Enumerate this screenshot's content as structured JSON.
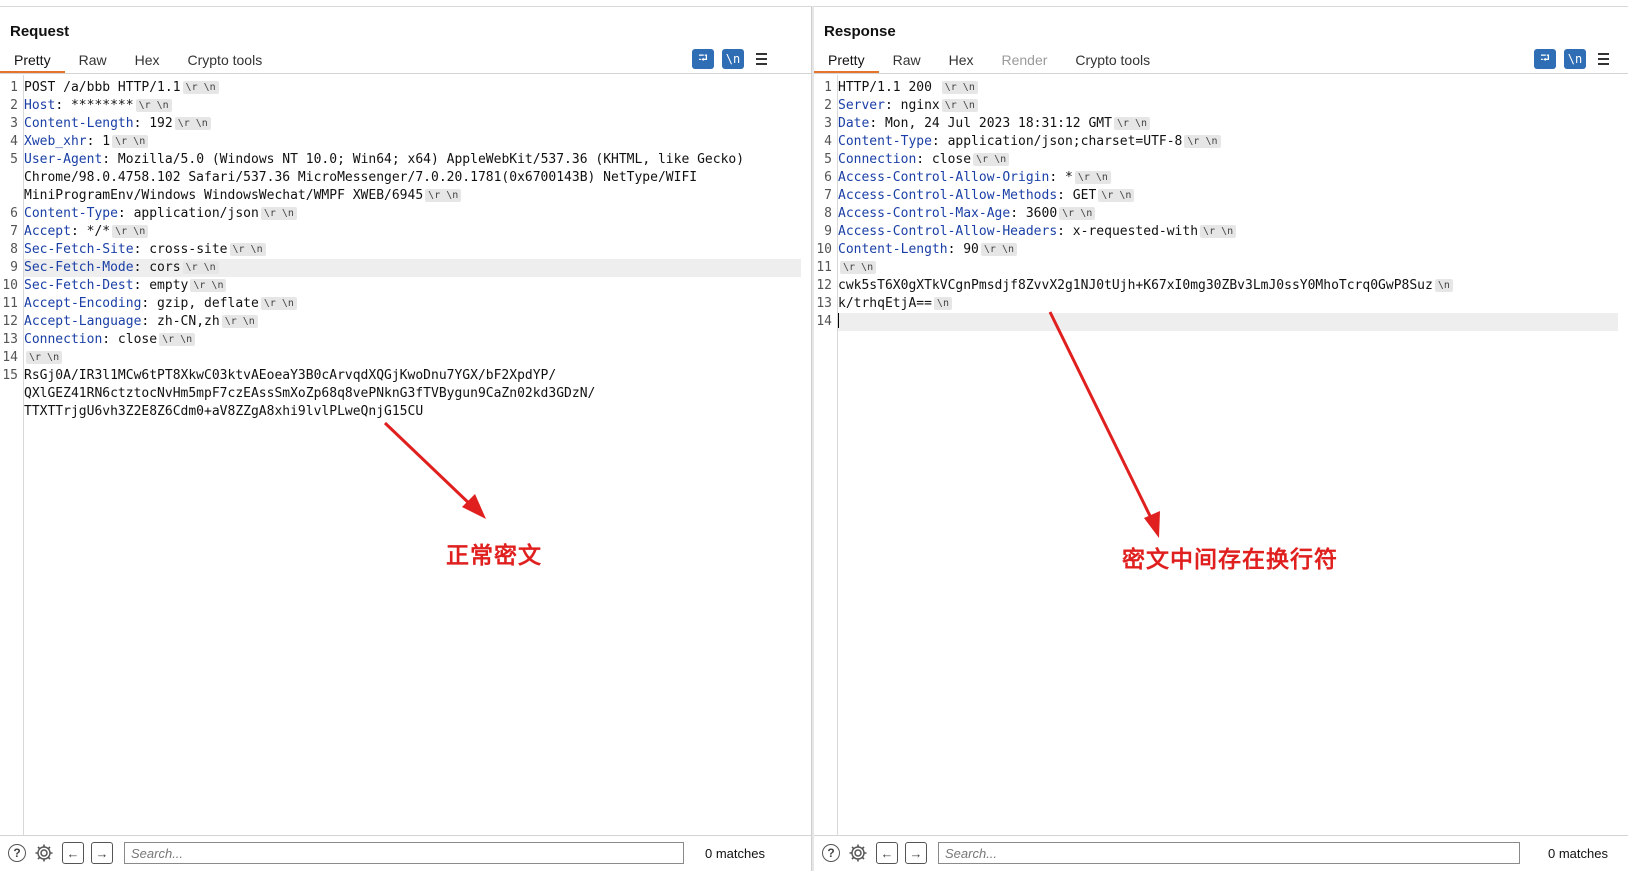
{
  "request": {
    "title": "Request",
    "tabs": [
      "Pretty",
      "Raw",
      "Hex",
      "Crypto tools"
    ],
    "active_tab": "Pretty",
    "lines": [
      {
        "n": "1",
        "key": "",
        "val": "POST /a/bbb HTTP/1.1",
        "eol": "\\r \\n"
      },
      {
        "n": "2",
        "key": "Host",
        "val": " ********",
        "eol": "\\r \\n"
      },
      {
        "n": "3",
        "key": "Content-Length",
        "val": " 192",
        "eol": "\\r \\n"
      },
      {
        "n": "4",
        "key": "Xweb_xhr",
        "val": " 1",
        "eol": "\\r \\n"
      },
      {
        "n": "5",
        "key": "User-Agent",
        "val": " Mozilla/5.0 (Windows NT 10.0; Win64; x64) AppleWebKit/537.36 (KHTML, like Gecko)",
        "eol": ""
      },
      {
        "n": "",
        "key": "",
        "val": "Chrome/98.0.4758.102 Safari/537.36 MicroMessenger/7.0.20.1781(0x6700143B) NetType/WIFI",
        "eol": ""
      },
      {
        "n": "",
        "key": "",
        "val": "MiniProgramEnv/Windows WindowsWechat/WMPF XWEB/6945",
        "eol": "\\r \\n"
      },
      {
        "n": "6",
        "key": "Content-Type",
        "val": " application/json",
        "eol": "\\r \\n"
      },
      {
        "n": "7",
        "key": "Accept",
        "val": " */*",
        "eol": "\\r \\n"
      },
      {
        "n": "8",
        "key": "Sec-Fetch-Site",
        "val": " cross-site",
        "eol": "\\r \\n"
      },
      {
        "n": "9",
        "key": "Sec-Fetch-Mode",
        "val": " cors",
        "eol": "\\r \\n",
        "highlight": true
      },
      {
        "n": "10",
        "key": "Sec-Fetch-Dest",
        "val": " empty",
        "eol": "\\r \\n"
      },
      {
        "n": "11",
        "key": "Accept-Encoding",
        "val": " gzip, deflate",
        "eol": "\\r \\n"
      },
      {
        "n": "12",
        "key": "Accept-Language",
        "val": " zh-CN,zh",
        "eol": "\\r \\n"
      },
      {
        "n": "13",
        "key": "Connection",
        "val": " close",
        "eol": "\\r \\n"
      },
      {
        "n": "14",
        "key": "",
        "val": "",
        "eol": "\\r \\n"
      },
      {
        "n": "15",
        "key": "",
        "val": "RsGj0A/IR3l1MCw6tPT8XkwC03ktvAEoeaY3B0cArvqdXQGjKwoDnu7YGX/bF2XpdYP/",
        "eol": ""
      },
      {
        "n": "",
        "key": "",
        "val": "QXlGEZ41RN6ctztocNvHm5mpF7czEAssSmXoZp68q8vePNknG3fTVBygun9CaZn02kd3GDzN/",
        "eol": ""
      },
      {
        "n": "",
        "key": "",
        "val": "TTXTTrjgU6vh3Z2E8Z6Cdm0+aV8ZZgA8xhi9lvlPLweQnjG15CU",
        "eol": ""
      }
    ],
    "search_placeholder": "Search...",
    "matches": "0 matches",
    "annotation": "正常密文"
  },
  "response": {
    "title": "Response",
    "tabs": [
      "Pretty",
      "Raw",
      "Hex",
      "Render",
      "Crypto tools"
    ],
    "active_tab": "Pretty",
    "lines": [
      {
        "n": "1",
        "key": "",
        "val": "HTTP/1.1 200 ",
        "eol": "\\r \\n"
      },
      {
        "n": "2",
        "key": "Server",
        "val": " nginx",
        "eol": "\\r \\n"
      },
      {
        "n": "3",
        "key": "Date",
        "val": " Mon, 24 Jul 2023 18:31:12 GMT",
        "eol": "\\r \\n"
      },
      {
        "n": "4",
        "key": "Content-Type",
        "val": " application/json;charset=UTF-8",
        "eol": "\\r \\n"
      },
      {
        "n": "5",
        "key": "Connection",
        "val": " close",
        "eol": "\\r \\n"
      },
      {
        "n": "6",
        "key": "Access-Control-Allow-Origin",
        "val": " *",
        "eol": "\\r \\n"
      },
      {
        "n": "7",
        "key": "Access-Control-Allow-Methods",
        "val": " GET",
        "eol": "\\r \\n"
      },
      {
        "n": "8",
        "key": "Access-Control-Max-Age",
        "val": " 3600",
        "eol": "\\r \\n"
      },
      {
        "n": "9",
        "key": "Access-Control-Allow-Headers",
        "val": " x-requested-with",
        "eol": "\\r \\n"
      },
      {
        "n": "10",
        "key": "Content-Length",
        "val": " 90",
        "eol": "\\r \\n"
      },
      {
        "n": "11",
        "key": "",
        "val": "",
        "eol": "\\r \\n"
      },
      {
        "n": "12",
        "key": "",
        "val": "cwk5sT6X0gXTkVCgnPmsdjf8ZvvX2g1NJ0tUjh+K67xI0mg30ZBv3LmJ0ssY0MhoTcrq0GwP8Suz",
        "eol": "\\n"
      },
      {
        "n": "13",
        "key": "",
        "val": "k/trhqEtjA==",
        "eol": "\\n"
      },
      {
        "n": "14",
        "key": "",
        "val": "",
        "eol": "",
        "cursor": true,
        "highlight": true
      }
    ],
    "search_placeholder": "Search...",
    "matches": "0 matches",
    "annotation": "密文中间存在换行符"
  },
  "icons": {
    "wrap": "word-wrap-icon",
    "newline": "show-newlines-icon",
    "menu": "hamburger-menu-icon",
    "help": "help-icon",
    "settings": "gear-icon",
    "back": "arrow-left-icon",
    "forward": "arrow-right-icon"
  },
  "colors": {
    "accent": "#2f6db4",
    "tab_underline": "#e8742c",
    "header_key": "#1a3fa6",
    "annotation": "#e0201f"
  }
}
